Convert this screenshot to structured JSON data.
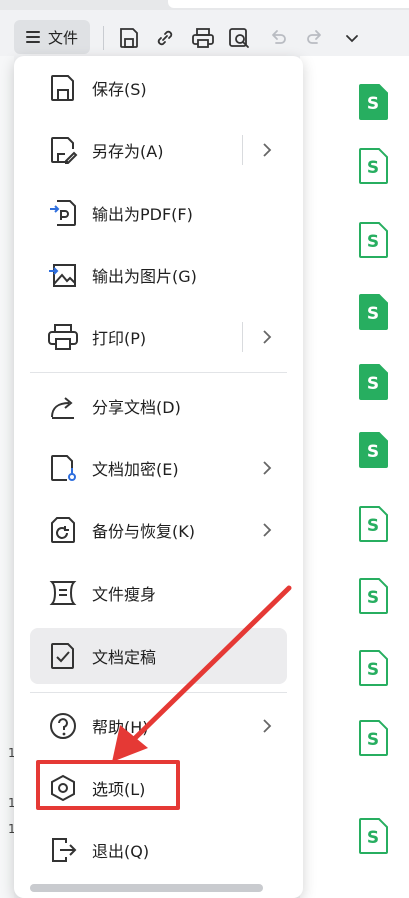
{
  "toolbar": {
    "file_menu_label": "文件",
    "icons": [
      "save-icon",
      "link-icon",
      "print-icon",
      "print-preview-icon",
      "undo-icon",
      "redo-icon",
      "more-dropdown-icon"
    ]
  },
  "menu": {
    "items": [
      {
        "label": "保存(S)",
        "icon": "save-icon"
      },
      {
        "label": "另存为(A)",
        "icon": "save-as-icon",
        "has_submenu": true
      },
      {
        "label": "输出为PDF(F)",
        "icon": "export-pdf-icon"
      },
      {
        "label": "输出为图片(G)",
        "icon": "export-image-icon"
      },
      {
        "label": "打印(P)",
        "icon": "print-icon",
        "has_submenu": true
      },
      {
        "label": "分享文档(D)",
        "icon": "share-icon"
      },
      {
        "label": "文档加密(E)",
        "icon": "encrypt-icon",
        "has_submenu": true
      },
      {
        "label": "备份与恢复(K)",
        "icon": "backup-icon",
        "has_submenu": true
      },
      {
        "label": "文件瘦身",
        "icon": "slim-icon"
      },
      {
        "label": "文档定稿",
        "icon": "finalize-icon",
        "active": true
      },
      {
        "label": "帮助(H)",
        "icon": "help-icon",
        "has_submenu": true
      },
      {
        "label": "选项(L)",
        "icon": "options-icon",
        "highlighted": true
      },
      {
        "label": "退出(Q)",
        "icon": "exit-icon"
      }
    ]
  },
  "background": {
    "file_icon_label": "S",
    "row_numbers": [
      "1",
      "1",
      "1"
    ]
  },
  "colors": {
    "annotation_red": "#e53935",
    "file_icon_green": "#27ae60",
    "menu_bg": "#ffffff",
    "active_item_bg": "#ececee"
  }
}
